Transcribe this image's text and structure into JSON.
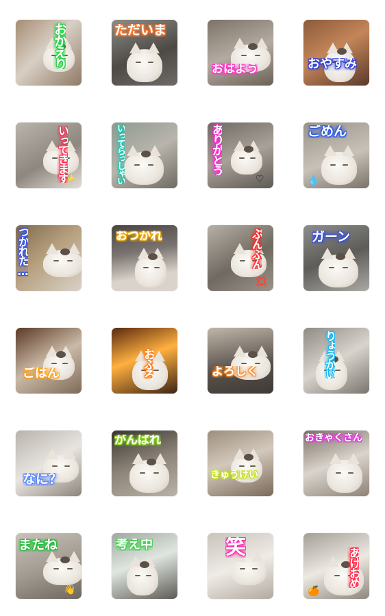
{
  "stickers": [
    {
      "caption": "おかえり",
      "glow": "#2bd24a",
      "vertical": true,
      "photo": "linear-gradient(135deg,#a68d74,#d8cfc4 45%,#8f7a66)"
    },
    {
      "caption": "ただいま",
      "glow": "#ff7a2e",
      "vertical": false,
      "photo": "linear-gradient(160deg,#8d8c86,#4d4a45 55%,#6e6b66)"
    },
    {
      "caption": "おはよう",
      "glow": "#ff39c4",
      "vertical": false,
      "photo": "linear-gradient(160deg,#7d7369,#b3aba1 50%,#6b6157)"
    },
    {
      "caption": "おやすみ",
      "glow": "#2f3fd6",
      "vertical": false,
      "photo": "linear-gradient(150deg,#8b5b3a,#c48559 45%,#5a3a2a)"
    },
    {
      "caption": "いってきます",
      "glow": "#ff2d55",
      "vertical": true,
      "photo": "linear-gradient(150deg,#b9b4ac,#8e8780 55%,#e3ded6)",
      "decoration": "✨"
    },
    {
      "caption": "いってらっしゃい",
      "glow": "#1cc9b0",
      "vertical": true,
      "photo": "linear-gradient(150deg,#8e9a91,#b8b4ac 50%,#6f6a62)"
    },
    {
      "caption": "ありがとう",
      "glow": "#ff26cf",
      "vertical": true,
      "photo": "linear-gradient(160deg,#6f6a64,#a8a198 50%,#5f5a55)",
      "decoration": "♡"
    },
    {
      "caption": "ごめん",
      "glow": "#2f5ae0",
      "vertical": false,
      "photo": "linear-gradient(160deg,#9a9389,#c7c1b8 55%,#7a736a)",
      "decoration": "💧"
    },
    {
      "caption": "つかれた…",
      "glow": "#3a55e6",
      "vertical": true,
      "photo": "linear-gradient(140deg,#7e6a4e,#b59f7d 45%,#d9d2c8)"
    },
    {
      "caption": "おつかれ",
      "glow": "#f2b21c",
      "vertical": false,
      "photo": "linear-gradient(170deg,#4a4543,#7a7370 40%,#d9d3cb 75%)"
    },
    {
      "caption": "ぷんぷん",
      "glow": "#ff2b2b",
      "vertical": true,
      "photo": "linear-gradient(150deg,#b7b0a6,#6f6961 55%,#9a938a)",
      "decoration": "💢"
    },
    {
      "caption": "ガーン",
      "glow": "#3a4fe0",
      "vertical": false,
      "photo": "linear-gradient(160deg,#8d8e8c,#5d5c58 50%,#a9a8a4)"
    },
    {
      "caption": "ごはん",
      "glow": "#ff9f1c",
      "vertical": false,
      "photo": "linear-gradient(150deg,#5c3a26,#c9b9a6 50%,#7e6a58)"
    },
    {
      "caption": "おふろ",
      "glow": "#ff7f1a",
      "vertical": true,
      "photo": "linear-gradient(160deg,#5a2a10,#ffb040 45%,#3d2414)"
    },
    {
      "caption": "よろしく",
      "glow": "#ff8c2a",
      "vertical": false,
      "photo": "linear-gradient(170deg,#bfb6a9,#57504a 60%,#3f3a36)"
    },
    {
      "caption": "りょうかい",
      "glow": "#19b8f2",
      "vertical": true,
      "photo": "linear-gradient(150deg,#8f8a84,#d8d3cd 50%,#7a756e)"
    },
    {
      "caption": "なに？",
      "glow": "#5a86ff",
      "vertical": false,
      "photo": "linear-gradient(150deg,#b8b3ad,#e8e4df 50%,#8c857c)"
    },
    {
      "caption": "がんばれ",
      "glow": "#8bd12a",
      "vertical": false,
      "photo": "linear-gradient(160deg,#3a3530,#8c8478 50%,#b9b2a8)"
    },
    {
      "caption": "きゅうけい",
      "glow": "#c5e02a",
      "vertical": false,
      "photo": "linear-gradient(160deg,#9c8e7e,#d2c8bb 45%,#7a6a5a)"
    },
    {
      "caption": "おきゃくさん",
      "glow": "#e535e0",
      "vertical": false,
      "photo": "linear-gradient(160deg,#7b6f62,#d9d4cd 50%,#8e8377)"
    },
    {
      "caption": "またね",
      "glow": "#21c03a",
      "vertical": false,
      "photo": "linear-gradient(160deg,#c8c2b9,#a39c92 50%,#6e675f)",
      "decoration": "👋"
    },
    {
      "caption": "考え中",
      "glow": "#3ed14a",
      "vertical": false,
      "photo": "linear-gradient(160deg,#9fa8a0,#dfe6e0 45%,#5e5a55)"
    },
    {
      "caption": "笑",
      "glow": "#ff2fb5",
      "vertical": false,
      "photo": "linear-gradient(160deg,#c9c3bb,#efebe6 50%,#b2aaa0)"
    },
    {
      "caption": "あけおめ",
      "glow": "#ff2b4a",
      "vertical": true,
      "photo": "linear-gradient(160deg,#a49e96,#ece8e2 50%,#8e877e)",
      "decoration": "🍊"
    }
  ]
}
